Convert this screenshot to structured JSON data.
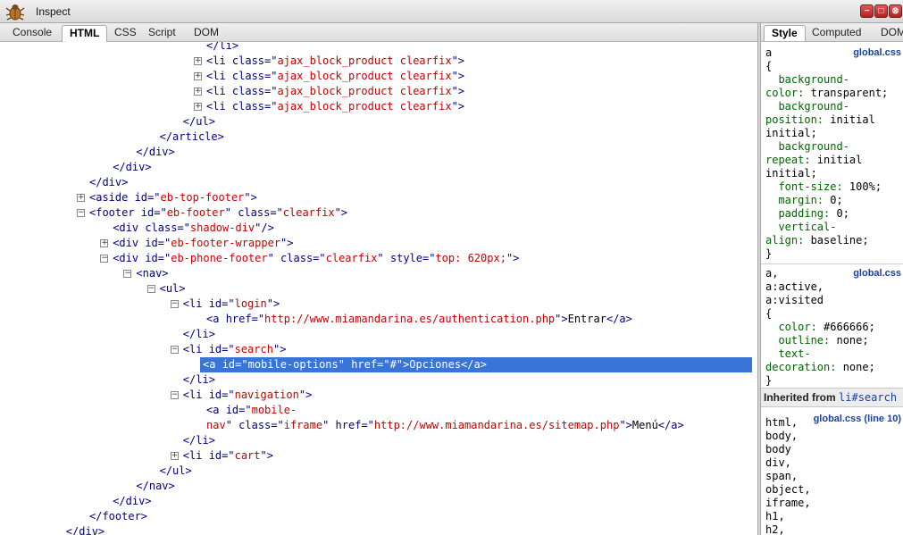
{
  "window": {
    "title": "Inspect"
  },
  "window_buttons": [
    "−",
    "□",
    "⊗"
  ],
  "tabs": [
    {
      "label": "Console"
    },
    {
      "label": "HTML",
      "active": true
    },
    {
      "label": "CSS"
    },
    {
      "label": "Script"
    },
    {
      "label": "DOM"
    }
  ],
  "side_tabs": [
    {
      "label": "Style",
      "active": true
    },
    {
      "label": "Computed"
    },
    {
      "label": "DOM"
    }
  ],
  "tree": [
    {
      "indent": 9,
      "toggle": null,
      "parts": [
        [
          "t",
          "</li>"
        ]
      ]
    },
    {
      "indent": 9,
      "toggle": "+",
      "parts": [
        [
          "t",
          "<li "
        ],
        [
          "a",
          "class"
        ],
        [
          "t",
          "=\""
        ],
        [
          "v",
          "ajax_block_product clearfix"
        ],
        [
          "t",
          "\">"
        ]
      ]
    },
    {
      "indent": 9,
      "toggle": "+",
      "parts": [
        [
          "t",
          "<li "
        ],
        [
          "a",
          "class"
        ],
        [
          "t",
          "=\""
        ],
        [
          "v",
          "ajax_block_product clearfix"
        ],
        [
          "t",
          "\">"
        ]
      ]
    },
    {
      "indent": 9,
      "toggle": "+",
      "parts": [
        [
          "t",
          "<li "
        ],
        [
          "a",
          "class"
        ],
        [
          "t",
          "=\""
        ],
        [
          "v",
          "ajax_block_product clearfix"
        ],
        [
          "t",
          "\">"
        ]
      ]
    },
    {
      "indent": 9,
      "toggle": "+",
      "parts": [
        [
          "t",
          "<li "
        ],
        [
          "a",
          "class"
        ],
        [
          "t",
          "=\""
        ],
        [
          "v",
          "ajax_block_product clearfix"
        ],
        [
          "t",
          "\">"
        ]
      ]
    },
    {
      "indent": 8,
      "toggle": null,
      "parts": [
        [
          "t",
          "</ul>"
        ]
      ]
    },
    {
      "indent": 7,
      "toggle": null,
      "parts": [
        [
          "t",
          "</article>"
        ]
      ]
    },
    {
      "indent": 6,
      "toggle": null,
      "parts": [
        [
          "t",
          "</div>"
        ]
      ]
    },
    {
      "indent": 5,
      "toggle": null,
      "parts": [
        [
          "t",
          "</div>"
        ]
      ]
    },
    {
      "indent": 4,
      "toggle": null,
      "parts": [
        [
          "t",
          "</div>"
        ]
      ]
    },
    {
      "indent": 4,
      "toggle": "+",
      "parts": [
        [
          "t",
          "<aside "
        ],
        [
          "a",
          "id"
        ],
        [
          "t",
          "=\""
        ],
        [
          "v",
          "eb-top-footer"
        ],
        [
          "t",
          "\">"
        ]
      ]
    },
    {
      "indent": 4,
      "toggle": "−",
      "parts": [
        [
          "t",
          "<footer "
        ],
        [
          "a",
          "id"
        ],
        [
          "t",
          "=\""
        ],
        [
          "v",
          "eb-footer"
        ],
        [
          "t",
          "\" "
        ],
        [
          "a",
          "class"
        ],
        [
          "t",
          "=\""
        ],
        [
          "v",
          "clearfix"
        ],
        [
          "t",
          "\">"
        ]
      ]
    },
    {
      "indent": 5,
      "toggle": null,
      "parts": [
        [
          "t",
          "<div "
        ],
        [
          "a",
          "class"
        ],
        [
          "t",
          "=\""
        ],
        [
          "v",
          "shadow-div"
        ],
        [
          "t",
          "\"/>"
        ]
      ]
    },
    {
      "indent": 5,
      "toggle": "+",
      "parts": [
        [
          "t",
          "<div "
        ],
        [
          "a",
          "id"
        ],
        [
          "t",
          "=\""
        ],
        [
          "v",
          "eb-footer-wrapper"
        ],
        [
          "t",
          "\">"
        ]
      ]
    },
    {
      "indent": 5,
      "toggle": "−",
      "parts": [
        [
          "t",
          "<div "
        ],
        [
          "a",
          "id"
        ],
        [
          "t",
          "=\""
        ],
        [
          "v",
          "eb-phone-footer"
        ],
        [
          "t",
          "\" "
        ],
        [
          "a",
          "class"
        ],
        [
          "t",
          "=\""
        ],
        [
          "v",
          "clearfix"
        ],
        [
          "t",
          "\" "
        ],
        [
          "a",
          "style"
        ],
        [
          "t",
          "=\""
        ],
        [
          "v",
          "top: 620px;"
        ],
        [
          "t",
          "\">"
        ]
      ]
    },
    {
      "indent": 6,
      "toggle": "−",
      "parts": [
        [
          "t",
          "<nav>"
        ]
      ]
    },
    {
      "indent": 7,
      "toggle": "−",
      "parts": [
        [
          "t",
          "<ul>"
        ]
      ]
    },
    {
      "indent": 8,
      "toggle": "−",
      "parts": [
        [
          "t",
          "<li "
        ],
        [
          "a",
          "id"
        ],
        [
          "t",
          "=\""
        ],
        [
          "v",
          "login"
        ],
        [
          "t",
          "\">"
        ]
      ]
    },
    {
      "indent": 9,
      "toggle": null,
      "parts": [
        [
          "t",
          "<a "
        ],
        [
          "a",
          "href"
        ],
        [
          "t",
          "=\""
        ],
        [
          "v",
          "http://www.miamandarina.es/authentication.php"
        ],
        [
          "t",
          "\">"
        ],
        [
          "x",
          "Entrar"
        ],
        [
          "t",
          "</a>"
        ]
      ]
    },
    {
      "indent": 8,
      "toggle": null,
      "parts": [
        [
          "t",
          "</li>"
        ]
      ]
    },
    {
      "indent": 8,
      "toggle": "−",
      "parts": [
        [
          "t",
          "<li "
        ],
        [
          "a",
          "id"
        ],
        [
          "t",
          "=\""
        ],
        [
          "v",
          "search"
        ],
        [
          "t",
          "\">"
        ]
      ]
    },
    {
      "indent": 9,
      "toggle": null,
      "selected": true,
      "parts": [
        [
          "t",
          "<a "
        ],
        [
          "a",
          "id"
        ],
        [
          "t",
          "=\""
        ],
        [
          "v",
          "mobile-options"
        ],
        [
          "t",
          "\" "
        ],
        [
          "a",
          "href"
        ],
        [
          "t",
          "=\""
        ],
        [
          "v",
          "#"
        ],
        [
          "t",
          "\">"
        ],
        [
          "x",
          "Opciones"
        ],
        [
          "t",
          "</a>"
        ]
      ]
    },
    {
      "indent": 8,
      "toggle": null,
      "parts": [
        [
          "t",
          "</li>"
        ]
      ]
    },
    {
      "indent": 8,
      "toggle": "−",
      "parts": [
        [
          "t",
          "<li "
        ],
        [
          "a",
          "id"
        ],
        [
          "t",
          "=\""
        ],
        [
          "v",
          "navigation"
        ],
        [
          "t",
          "\">"
        ]
      ]
    },
    {
      "indent": 9,
      "toggle": null,
      "parts": [
        [
          "t",
          "<a "
        ],
        [
          "a",
          "id"
        ],
        [
          "t",
          "=\""
        ],
        [
          "v",
          "mobile-"
        ]
      ]
    },
    {
      "indent": 9,
      "toggle": null,
      "parts": [
        [
          "v",
          "nav"
        ],
        [
          "t",
          "\" "
        ],
        [
          "a",
          "class"
        ],
        [
          "t",
          "=\""
        ],
        [
          "v",
          "iframe"
        ],
        [
          "t",
          "\" "
        ],
        [
          "a",
          "href"
        ],
        [
          "t",
          "=\""
        ],
        [
          "v",
          "http://www.miamandarina.es/sitemap.php"
        ],
        [
          "t",
          "\">"
        ],
        [
          "x",
          "Menú"
        ],
        [
          "t",
          "</a>"
        ]
      ]
    },
    {
      "indent": 8,
      "toggle": null,
      "parts": [
        [
          "t",
          "</li>"
        ]
      ]
    },
    {
      "indent": 8,
      "toggle": "+",
      "parts": [
        [
          "t",
          "<li "
        ],
        [
          "a",
          "id"
        ],
        [
          "t",
          "=\""
        ],
        [
          "v",
          "cart"
        ],
        [
          "t",
          "\">"
        ]
      ]
    },
    {
      "indent": 7,
      "toggle": null,
      "parts": [
        [
          "t",
          "</ul>"
        ]
      ]
    },
    {
      "indent": 6,
      "toggle": null,
      "parts": [
        [
          "t",
          "</nav>"
        ]
      ]
    },
    {
      "indent": 5,
      "toggle": null,
      "parts": [
        [
          "t",
          "</div>"
        ]
      ]
    },
    {
      "indent": 4,
      "toggle": null,
      "parts": [
        [
          "t",
          "</footer>"
        ]
      ]
    },
    {
      "indent": 3,
      "toggle": null,
      "parts": [
        [
          "t",
          "</div>"
        ]
      ]
    }
  ],
  "style_rules": [
    {
      "file": "global.css",
      "lines": [
        [
          [
            "s",
            "a"
          ]
        ],
        [
          [
            "s",
            "{"
          ]
        ],
        [
          [
            "p",
            "  background-"
          ]
        ],
        [
          [
            "p",
            "color: "
          ],
          [
            "s",
            "transparent;"
          ]
        ],
        [
          [
            "p",
            "  background-"
          ]
        ],
        [
          [
            "p",
            "position: "
          ],
          [
            "s",
            "initial"
          ]
        ],
        [
          [
            "s",
            "initial;"
          ]
        ],
        [
          [
            "p",
            "  background-"
          ]
        ],
        [
          [
            "p",
            "repeat: "
          ],
          [
            "s",
            "initial"
          ]
        ],
        [
          [
            "s",
            "initial;"
          ]
        ],
        [
          [
            "p",
            "  font-size: "
          ],
          [
            "s",
            "100%;"
          ]
        ],
        [
          [
            "p",
            "  margin: "
          ],
          [
            "s",
            "0;"
          ]
        ],
        [
          [
            "p",
            "  padding: "
          ],
          [
            "s",
            "0;"
          ]
        ],
        [
          [
            "p",
            "  vertical-"
          ]
        ],
        [
          [
            "p",
            "align: "
          ],
          [
            "s",
            "baseline;"
          ]
        ],
        [
          [
            "s",
            "}"
          ]
        ]
      ]
    },
    {
      "file": "global.css",
      "lines": [
        [
          [
            "s",
            "a,"
          ]
        ],
        [
          [
            "s",
            "a:active,"
          ]
        ],
        [
          [
            "s",
            "a:visited"
          ]
        ],
        [
          [
            "s",
            "{"
          ]
        ],
        [
          [
            "p",
            "  color: "
          ],
          [
            "s",
            "#666666;"
          ]
        ],
        [
          [
            "p",
            "  outline: "
          ],
          [
            "s",
            "none;"
          ]
        ],
        [
          [
            "p",
            "  text-"
          ]
        ],
        [
          [
            "p",
            "decoration: "
          ],
          [
            "s",
            "none;"
          ]
        ],
        [
          [
            "s",
            "}"
          ]
        ]
      ]
    }
  ],
  "inherited": {
    "label": "Inherited from",
    "selector": "li#search",
    "file": "global.css (line 10)",
    "lines": [
      "html,",
      "body,",
      "body",
      "div,",
      "span,",
      "object,",
      "iframe,",
      "h1,",
      "h2,"
    ]
  }
}
